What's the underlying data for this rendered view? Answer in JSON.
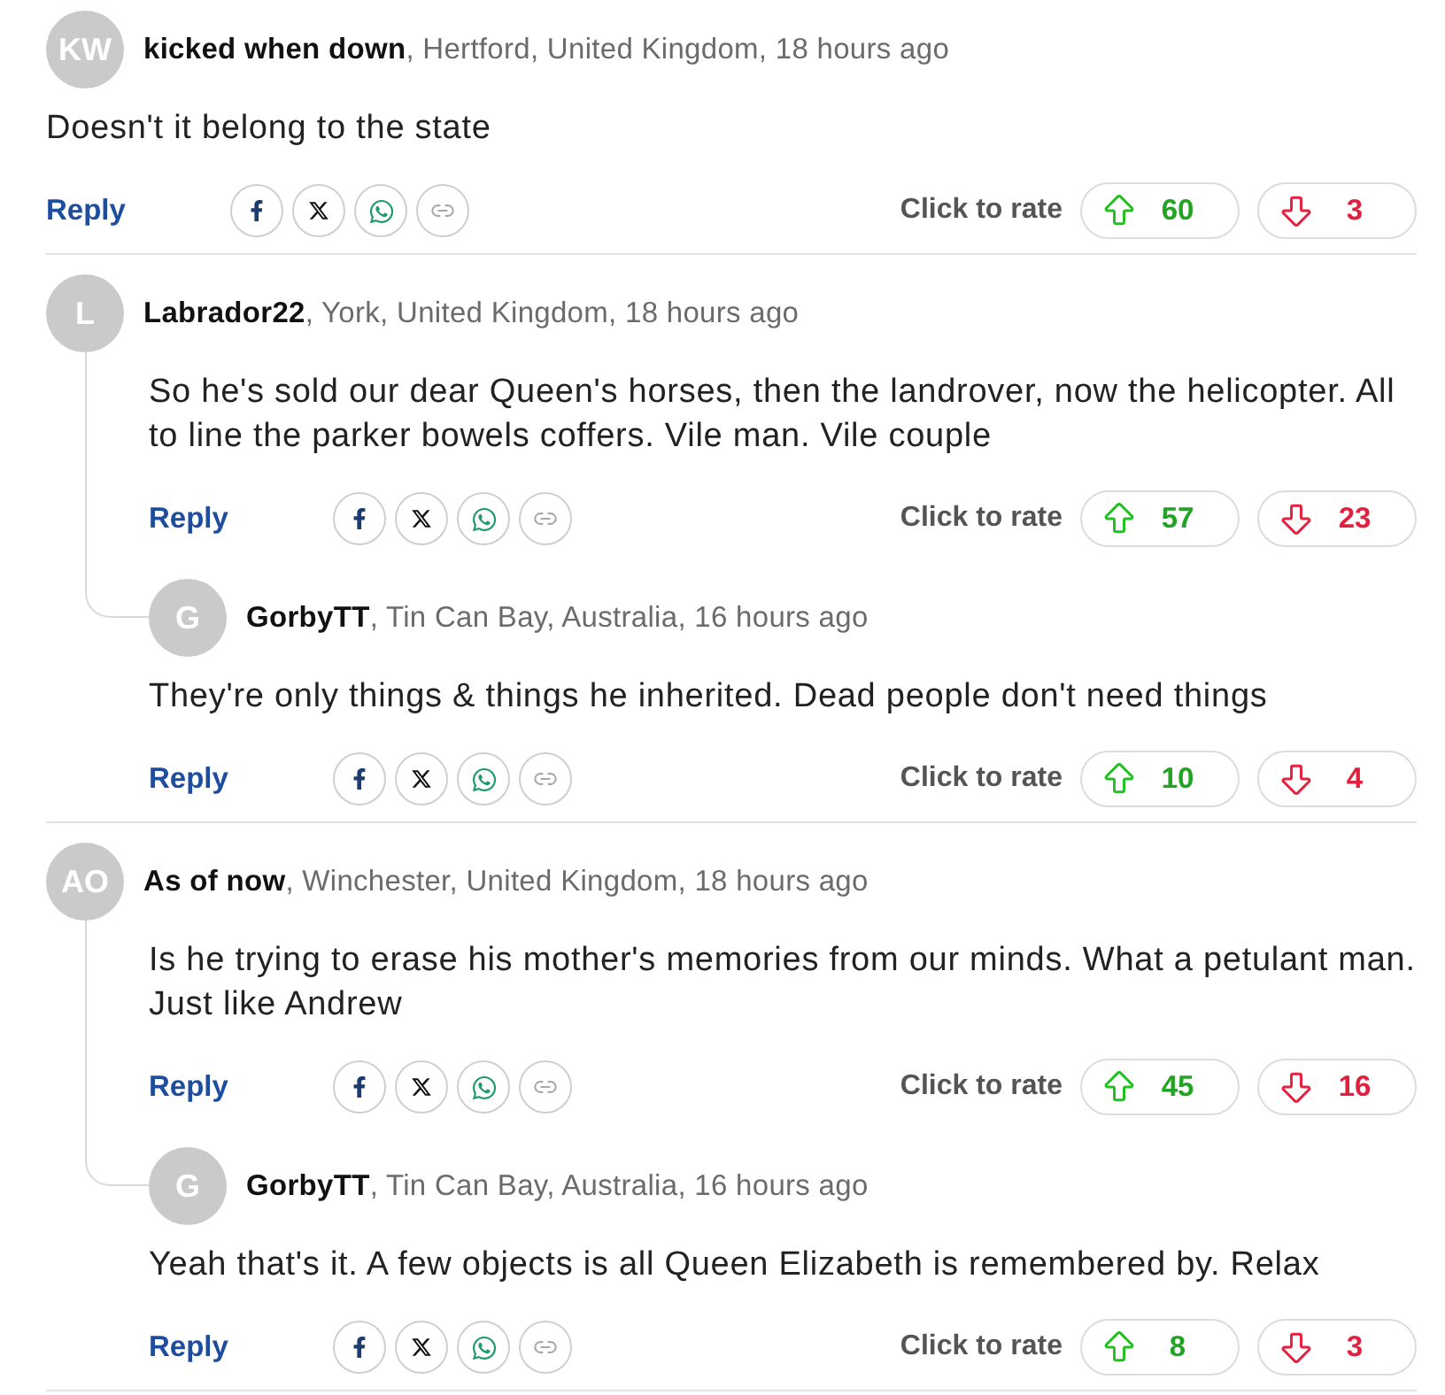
{
  "comments": [
    {
      "initials": "KW",
      "byline": "**kicked when down**, Hertford, United Kingdom, 18 hours ago",
      "body": "Doesn't it belong to the state",
      "reply_label": "Reply",
      "rate_label": "Click to rate",
      "up_votes": "60",
      "down_votes": "3"
    },
    {
      "initials": "L",
      "byline": "**Labrador22**, York, United Kingdom, 18 hours ago",
      "body": "So he's sold our dear Queen's horses, then the landrover, now the helicopter. All to line the parker bowels coffers. Vile man. Vile couple",
      "reply_label": "Reply",
      "rate_label": "Click to rate",
      "up_votes": "57",
      "down_votes": "23",
      "replies": [
        {
          "initials": "G",
          "byline": "**GorbyTT**, Tin Can Bay, Australia, 16 hours ago",
          "body": "They're only things & things he inherited. Dead people don't need things",
          "reply_label": "Reply",
          "rate_label": "Click to rate",
          "up_votes": "10",
          "down_votes": "4"
        }
      ]
    },
    {
      "initials": "AO",
      "byline": "**As of now**, Winchester, United Kingdom, 18 hours ago",
      "body": "Is he trying to erase his mother's memories from our minds. What a petulant man. Just like Andrew",
      "reply_label": "Reply",
      "rate_label": "Click to rate",
      "up_votes": "45",
      "down_votes": "16",
      "replies": [
        {
          "initials": "G",
          "byline": "**GorbyTT**, Tin Can Bay, Australia, 16 hours ago",
          "body": "Yeah that's it. A few objects is all Queen Elizabeth is remembered by. Relax",
          "reply_label": "Reply",
          "rate_label": "Click to rate",
          "up_votes": "8",
          "down_votes": "3"
        }
      ]
    }
  ]
}
